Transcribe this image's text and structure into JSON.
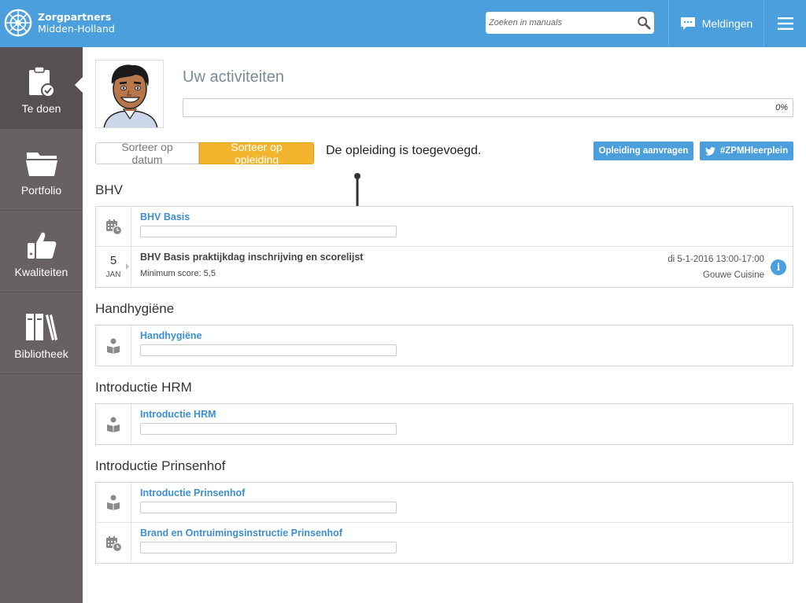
{
  "header": {
    "brand_line1": "Zorgpartners",
    "brand_line2": "Midden-Holland",
    "search_placeholder": "Zoeken in manuals",
    "notifications_label": "Meldingen"
  },
  "sidebar": {
    "items": [
      {
        "label": "Te doen",
        "icon": "clipboard-check-icon",
        "active": true
      },
      {
        "label": "Portfolio",
        "icon": "folder-icon"
      },
      {
        "label": "Kwaliteiten",
        "icon": "thumbs-up-icon"
      },
      {
        "label": "Bibliotheek",
        "icon": "books-icon"
      }
    ]
  },
  "activity": {
    "title": "Uw activiteiten",
    "progress_label": "0%",
    "progress": 0
  },
  "sort": {
    "by_date": "Sorteer op datum",
    "by_course": "Sorteer op opleiding"
  },
  "notice": "De opleiding is toegevoegd.",
  "actions": {
    "request_course": "Opleiding aanvragen",
    "hashtag": "#ZPMHleerplein"
  },
  "sections": [
    {
      "title": "BHV",
      "rows": [
        {
          "type": "course",
          "icon": "calendar-clock-icon",
          "title": "BHV Basis"
        },
        {
          "type": "event",
          "day": "5",
          "month": "JAN",
          "title": "BHV Basis praktijkdag inschrijving en scorelijst",
          "min_score": "Minimum score: 5,5",
          "date": "di 5-1-2016 13:00-17:00",
          "location": "Gouwe Cuisine"
        }
      ]
    },
    {
      "title": "Handhygiëne",
      "rows": [
        {
          "type": "course",
          "icon": "reader-icon",
          "title": "Handhygiëne"
        }
      ]
    },
    {
      "title": "Introductie HRM",
      "rows": [
        {
          "type": "course",
          "icon": "reader-icon",
          "title": "Introductie HRM"
        }
      ]
    },
    {
      "title": "Introductie Prinsenhof",
      "rows": [
        {
          "type": "course",
          "icon": "reader-icon",
          "title": "Introductie Prinsenhof"
        },
        {
          "type": "course",
          "icon": "calendar-clock-icon",
          "title": "Brand en Ontruimingsinstructie Prinsenhof"
        }
      ]
    }
  ],
  "colors": {
    "header_blue": "#4a9fdc",
    "sidebar_gray": "#676163",
    "accent_orange": "#f3b52e",
    "link_blue": "#3d8fd2"
  }
}
